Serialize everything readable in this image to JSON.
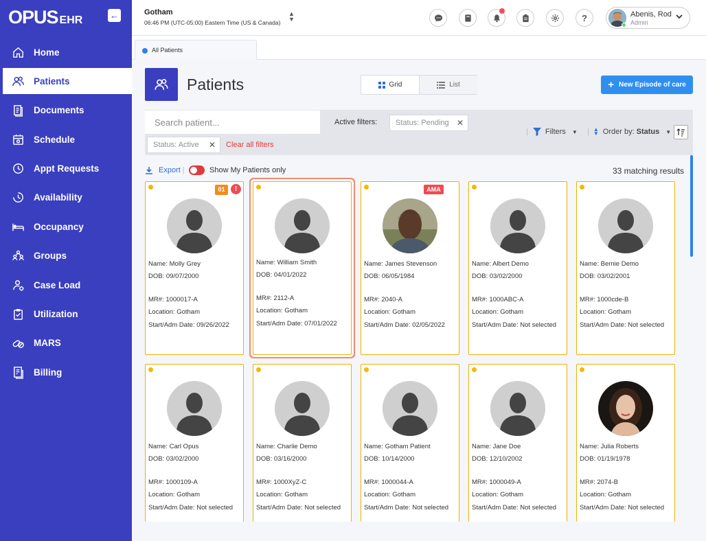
{
  "app": {
    "logo": "OPUS",
    "logo_suffix": "EHR",
    "collapse_icon": "arrow-left-icon"
  },
  "sidebar": {
    "items": [
      {
        "label": "Home",
        "icon": "home-icon",
        "active": false
      },
      {
        "label": "Patients",
        "icon": "users-icon",
        "active": true
      },
      {
        "label": "Documents",
        "icon": "documents-icon",
        "active": false
      },
      {
        "label": "Schedule",
        "icon": "calendar-icon",
        "active": false
      },
      {
        "label": "Appt Requests",
        "icon": "clock-icon",
        "active": false
      },
      {
        "label": "Availability",
        "icon": "availability-icon",
        "active": false
      },
      {
        "label": "Occupancy",
        "icon": "bed-icon",
        "active": false
      },
      {
        "label": "Groups",
        "icon": "groups-icon",
        "active": false
      },
      {
        "label": "Case Load",
        "icon": "case-load-icon",
        "active": false
      },
      {
        "label": "Utilization",
        "icon": "checklist-icon",
        "active": false
      },
      {
        "label": "MARS",
        "icon": "pills-icon",
        "active": false
      },
      {
        "label": "Billing",
        "icon": "billing-icon",
        "active": false
      }
    ]
  },
  "topbar": {
    "org_name": "Gotham",
    "org_time": "06:46 PM (UTC-05:00) Eastern Time (US & Canada)",
    "icons": [
      "chat-icon",
      "book-icon",
      "bell-icon",
      "clipboard-icon",
      "gear-icon",
      "help-icon"
    ],
    "user_name": "Abenis, Rod",
    "user_role": "Admin"
  },
  "tabs": [
    {
      "label": "All Patients"
    }
  ],
  "page": {
    "title": "Patients",
    "view_grid_label": "Grid",
    "view_list_label": "List",
    "new_button_label": "New Episode of care"
  },
  "filters": {
    "search_placeholder": "Search patient...",
    "active_label": "Active filters:",
    "chips": [
      "Status: Pending",
      "Status: Active"
    ],
    "clear_label": "Clear all filters",
    "filters_label": "Filters",
    "order_prefix": "Order by:",
    "order_value": "Status"
  },
  "toolbar": {
    "export_label": "Export",
    "toggle_label": "Show My Patients only",
    "match_count": "33 matching results"
  },
  "patients": [
    {
      "name": "Name: Molly Grey",
      "dob": "DOB: 09/07/2000",
      "mr": "MR#: 1000017-A",
      "location": "Location: Gotham",
      "start": "Start/Adm Date: 09/26/2022",
      "badge_num": "01",
      "badge_alert": "!",
      "badge_ama": "",
      "photo": "default"
    },
    {
      "name": "Name: William Smith",
      "dob": "DOB: 04/01/2022",
      "mr": "MR#: 2112-A",
      "location": "Location: Gotham",
      "start": "Start/Adm Date: 07/01/2022",
      "badge_num": "",
      "badge_alert": "",
      "badge_ama": "",
      "photo": "default"
    },
    {
      "name": "Name: James Stevenson",
      "dob": "DOB: 06/05/1984",
      "mr": "MR#: 2040-A",
      "location": "Location: Gotham",
      "start": "Start/Adm Date: 02/05/2022",
      "badge_num": "",
      "badge_alert": "",
      "badge_ama": "AMA",
      "photo": "man"
    },
    {
      "name": "Name: Albert Demo",
      "dob": "DOB: 03/02/2000",
      "mr": "MR#: 1000ABC-A",
      "location": "Location: Gotham",
      "start": "Start/Adm Date: Not selected",
      "badge_num": "",
      "badge_alert": "",
      "badge_ama": "",
      "photo": "default"
    },
    {
      "name": "Name: Bernie Demo",
      "dob": "DOB: 03/02/2001",
      "mr": "MR#: 1000cde-B",
      "location": "Location: Gotham",
      "start": "Start/Adm Date: Not selected",
      "badge_num": "",
      "badge_alert": "",
      "badge_ama": "",
      "photo": "default"
    },
    {
      "name": "Name: Carl Opus",
      "dob": "DOB: 03/02/2000",
      "mr": "MR#: 1000109-A",
      "location": "Location: Gotham",
      "start": "Start/Adm Date: Not selected",
      "badge_num": "",
      "badge_alert": "",
      "badge_ama": "",
      "photo": "default"
    },
    {
      "name": "Name: Charlie Demo",
      "dob": "DOB: 03/16/2000",
      "mr": "MR#: 1000XyZ-C",
      "location": "Location: Gotham",
      "start": "Start/Adm Date: Not selected",
      "badge_num": "",
      "badge_alert": "",
      "badge_ama": "",
      "photo": "default"
    },
    {
      "name": "Name: Gotham Patient",
      "dob": "DOB: 10/14/2000",
      "mr": "MR#: 1000044-A",
      "location": "Location: Gotham",
      "start": "Start/Adm Date: Not selected",
      "badge_num": "",
      "badge_alert": "",
      "badge_ama": "",
      "photo": "default"
    },
    {
      "name": "Name: Jane Doe",
      "dob": "DOB: 12/10/2002",
      "mr": "MR#: 1000049-A",
      "location": "Location: Gotham",
      "start": "Start/Adm Date: Not selected",
      "badge_num": "",
      "badge_alert": "",
      "badge_ama": "",
      "photo": "default"
    },
    {
      "name": "Name: Julia Roberts",
      "dob": "DOB: 01/19/1978",
      "mr": "MR#: 2074-B",
      "location": "Location: Gotham",
      "start": "Start/Adm Date: Not selected",
      "badge_num": "",
      "badge_alert": "",
      "badge_ama": "",
      "photo": "woman"
    }
  ],
  "colors": {
    "sidebar": "#3a3fbf",
    "primary_button": "#2f8ff0",
    "card_border": "#f0b000",
    "status_dot": "#f5b800",
    "alert": "#ee4b55",
    "badge_orange": "#f28c1e"
  }
}
